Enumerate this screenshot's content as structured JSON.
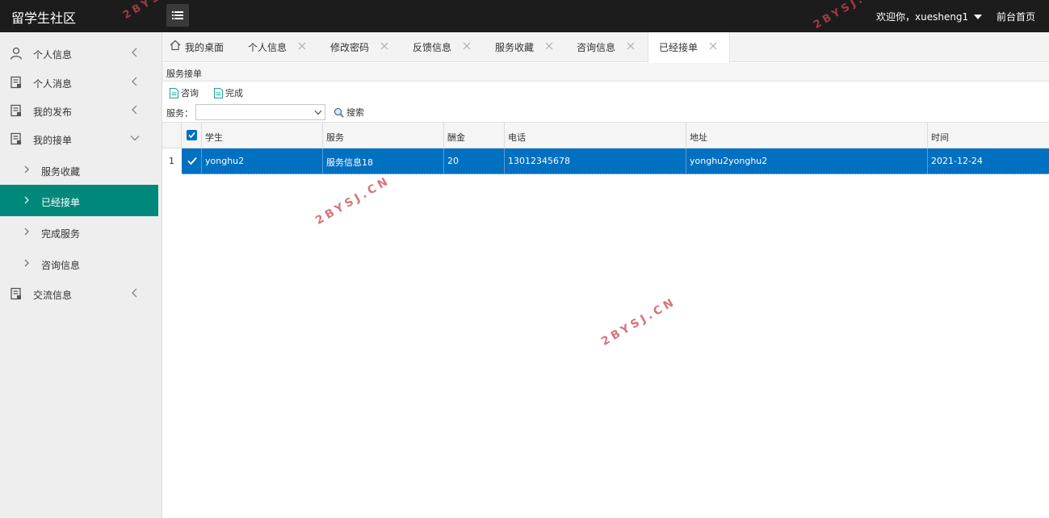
{
  "header": {
    "title": "留学生社区",
    "user_greeting": "欢迎你，xuesheng1",
    "front_link": "前台首页"
  },
  "sidebar": {
    "items": [
      {
        "label": "个人信息",
        "icon": "user-icon",
        "expanded": false
      },
      {
        "label": "个人消息",
        "icon": "document-icon",
        "expanded": false
      },
      {
        "label": "我的发布",
        "icon": "document-icon",
        "expanded": false
      },
      {
        "label": "我的接单",
        "icon": "document-icon",
        "expanded": true
      },
      {
        "label": "交流信息",
        "icon": "document-icon",
        "expanded": false
      }
    ],
    "sub_items": [
      {
        "label": "服务收藏"
      },
      {
        "label": "已经接单",
        "active": true
      },
      {
        "label": "完成服务"
      },
      {
        "label": "咨询信息"
      }
    ]
  },
  "tabs": [
    {
      "label": "我的桌面",
      "icon": "home-icon"
    },
    {
      "label": "个人信息"
    },
    {
      "label": "修改密码"
    },
    {
      "label": "反馈信息"
    },
    {
      "label": "服务收藏"
    },
    {
      "label": "咨询信息"
    },
    {
      "label": "已经接单",
      "active": true
    }
  ],
  "panel": {
    "title": "服务接单",
    "toolbar": {
      "consult_label": "咨询",
      "complete_label": "完成"
    },
    "search": {
      "label": "服务：",
      "value": "",
      "button_label": "搜索"
    }
  },
  "grid": {
    "columns": [
      "学生",
      "服务",
      "酬金",
      "电话",
      "地址",
      "时间"
    ],
    "rows": [
      {
        "num": "1",
        "selected": true,
        "cells": [
          "yonghu2",
          "服务信息18",
          "20",
          "13012345678",
          "yonghu2yonghu2",
          "2021-12-24"
        ]
      }
    ]
  },
  "watermarks": [
    "2BYSJ.CN",
    "2BYSJ.CN",
    "2BYSJ.CN",
    "2BYSJ.CN"
  ],
  "colors": {
    "header_bg": "#1c1c1c",
    "sidebar_active": "#00897b",
    "selected_row": "#0070c0",
    "toolbar_icon": "#1aa094"
  }
}
